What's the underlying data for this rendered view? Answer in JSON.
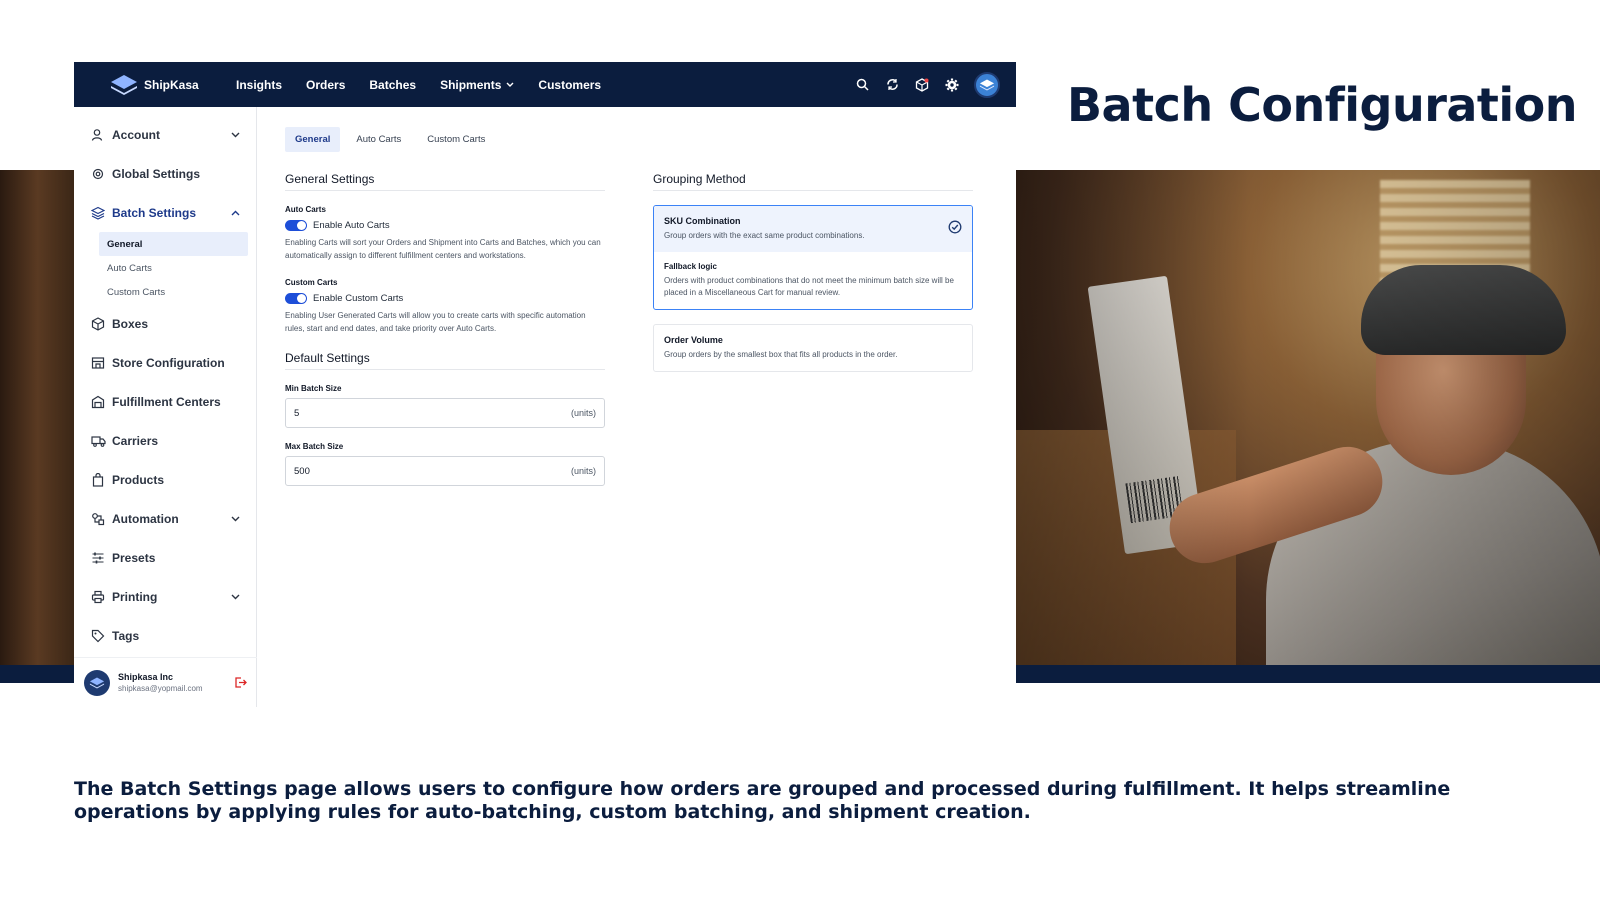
{
  "brand": {
    "name": "ShipKasa"
  },
  "topnav": {
    "items": [
      {
        "label": "Insights"
      },
      {
        "label": "Orders"
      },
      {
        "label": "Batches"
      },
      {
        "label": "Shipments"
      },
      {
        "label": "Customers"
      }
    ],
    "icons": [
      "search-icon",
      "sync-icon",
      "package-icon",
      "gear-icon",
      "profile-avatar"
    ]
  },
  "sidebar": {
    "items": [
      {
        "label": "Account",
        "icon": "user-icon"
      },
      {
        "label": "Global Settings",
        "icon": "settings-icon"
      },
      {
        "label": "Batch Settings",
        "icon": "layers-icon"
      },
      {
        "label": "Boxes",
        "icon": "box-icon"
      },
      {
        "label": "Store Configuration",
        "icon": "store-icon"
      },
      {
        "label": "Fulfillment Centers",
        "icon": "warehouse-icon"
      },
      {
        "label": "Carriers",
        "icon": "truck-icon"
      },
      {
        "label": "Products",
        "icon": "bag-icon"
      },
      {
        "label": "Automation",
        "icon": "automation-icon"
      },
      {
        "label": "Presets",
        "icon": "sliders-icon"
      },
      {
        "label": "Printing",
        "icon": "printer-icon"
      },
      {
        "label": "Tags",
        "icon": "tag-icon"
      }
    ],
    "batch_sub": [
      {
        "label": "General"
      },
      {
        "label": "Auto Carts"
      },
      {
        "label": "Custom Carts"
      }
    ],
    "user": {
      "name": "Shipkasa Inc",
      "email": "shipkasa@yopmail.com"
    }
  },
  "tabs": [
    {
      "label": "General"
    },
    {
      "label": "Auto Carts"
    },
    {
      "label": "Custom Carts"
    }
  ],
  "general": {
    "title": "General Settings",
    "auto_carts": {
      "label": "Auto Carts",
      "toggle_label": "Enable Auto Carts",
      "help": "Enabling Carts will sort your Orders and Shipment into Carts and Batches, which you can automatically assign to different fulfillment centers and workstations."
    },
    "custom_carts": {
      "label": "Custom Carts",
      "toggle_label": "Enable Custom Carts",
      "help": "Enabling User Generated Carts will allow you to create carts with specific automation rules, start and end dates, and take priority over Auto Carts."
    }
  },
  "defaults": {
    "title": "Default Settings",
    "min": {
      "label": "Min Batch Size",
      "value": "5",
      "unit": "(units)"
    },
    "max": {
      "label": "Max Batch Size",
      "value": "500",
      "unit": "(units)"
    }
  },
  "grouping": {
    "title": "Grouping Method",
    "sku": {
      "title": "SKU Combination",
      "desc": "Group orders with the exact same product combinations."
    },
    "fallback": {
      "title": "Fallback logic",
      "desc": "Orders with product combinations that do not meet the minimum batch size will be placed in a Miscellaneous Cart for manual review."
    },
    "volume": {
      "title": "Order Volume",
      "desc": "Group orders by the smallest box that fits all products in the order."
    }
  },
  "headline": "Batch Configuration",
  "description": "The Batch Settings page allows users to configure how orders are grouped and processed during fulfillment. It helps streamline operations by applying rules for auto-batching, custom batching, and shipment creation.",
  "colors": {
    "navy": "#0b1d3e",
    "accent": "#1d4ed8",
    "selected_bg": "#eef3fd"
  }
}
